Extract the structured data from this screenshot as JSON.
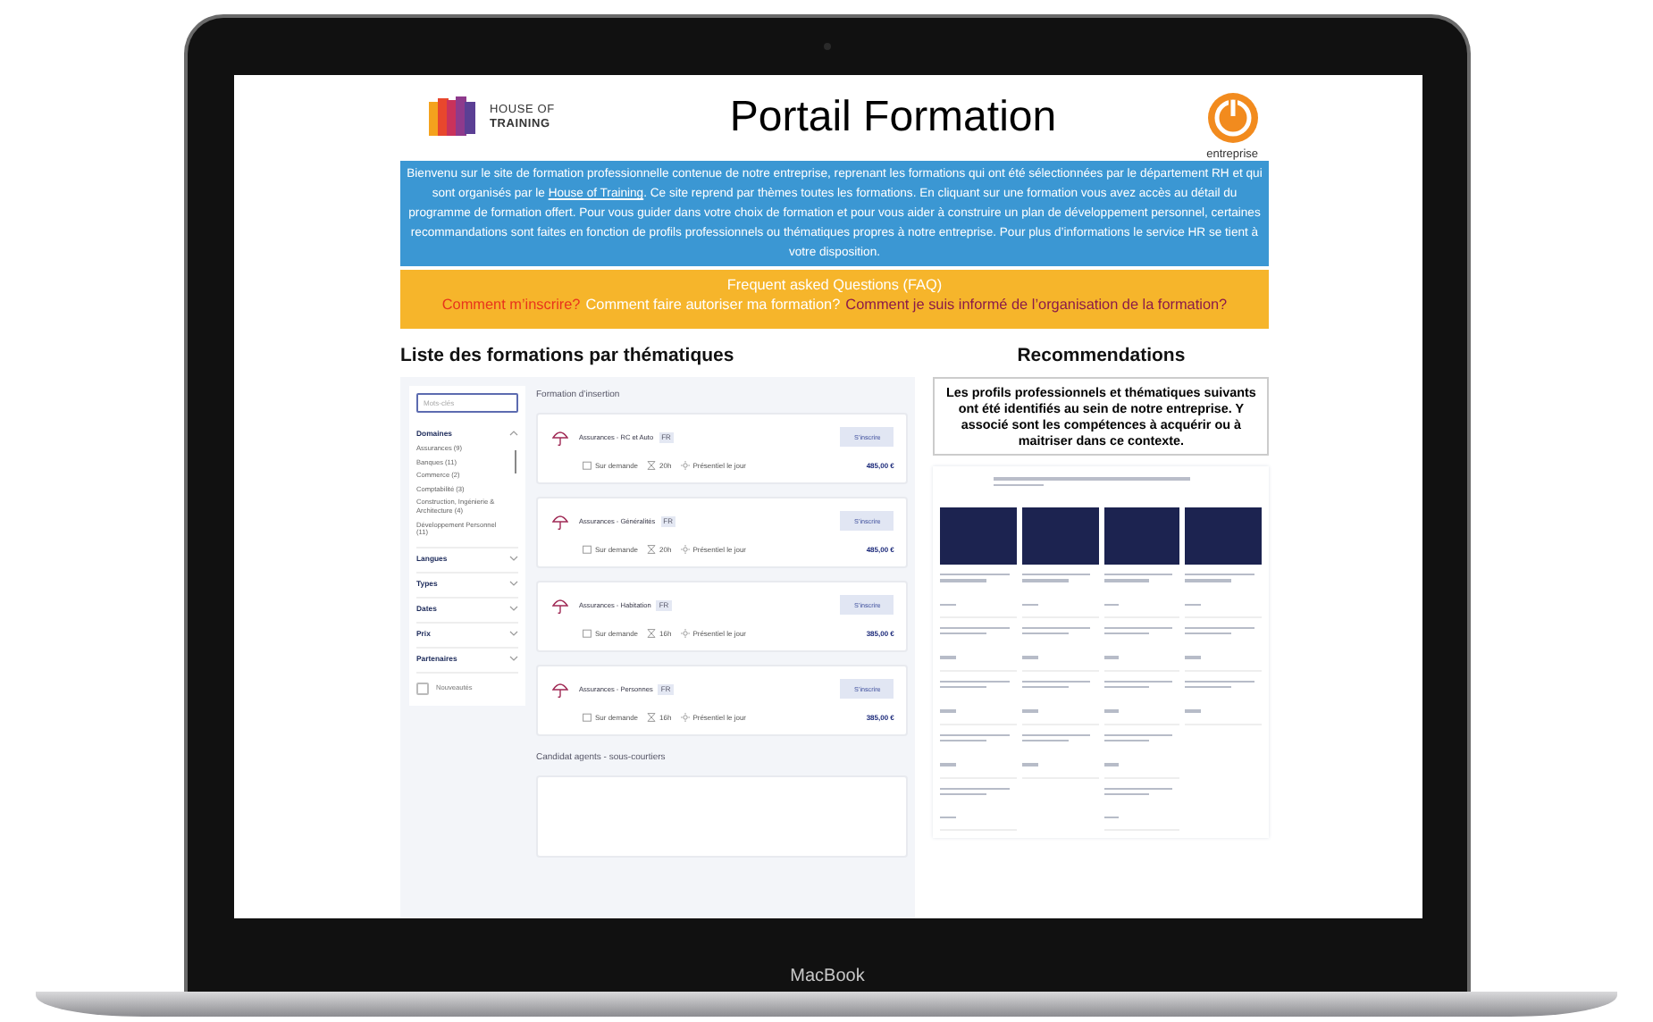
{
  "device": {
    "label": "MacBook"
  },
  "header": {
    "logo_lines": [
      "HOUSE OF",
      "TRAINING"
    ],
    "title": "Portail Formation",
    "partner_label": "entreprise"
  },
  "intro": {
    "before": "Bienvenu sur le site de formation professionnelle contenue de notre entreprise, reprenant les formations qui ont été sélectionnées par le département RH et qui sont organisés par le ",
    "link": "House of Training",
    "after": ". Ce site reprend par thèmes toutes les formations. En cliquant sur une formation vous avez accès au détail du programme de formation offert. Pour vous guider dans votre choix de formation et pour vous aider à construire un plan de développement personnel, certaines recommandations sont faites en fonction de profils professionnels ou thématiques propres à notre entreprise. Pour plus d’informations le service HR se tient à votre disposition."
  },
  "faq": {
    "title": "Frequent asked Questions (FAQ)",
    "links": [
      {
        "text": "Comment m’inscrire?",
        "color": "#e8341c"
      },
      {
        "text": "Comment faire autoriser ma formation?",
        "color": "#ffffff"
      },
      {
        "text": "Comment je suis informé de l’organisation de la formation?",
        "color": "#8b1a4a"
      }
    ]
  },
  "catalog": {
    "heading": "Liste des formations par thématiques",
    "search": {
      "placeholder": "Mots-clés"
    },
    "filters": [
      {
        "label": "Domaines",
        "expanded": true,
        "options": [
          "Assurances (9)",
          "Banques (11)",
          "Commerce (2)",
          "Comptabilité (3)",
          "Construction, Ingénierie & Architecture (4)",
          "Développement Personnel (11)"
        ]
      },
      {
        "label": "Langues",
        "expanded": false
      },
      {
        "label": "Types",
        "expanded": false
      },
      {
        "label": "Dates",
        "expanded": false
      },
      {
        "label": "Prix",
        "expanded": false
      },
      {
        "label": "Partenaires",
        "expanded": false
      }
    ],
    "new_only": {
      "label": "Nouveautés",
      "checked": false
    },
    "sections": [
      {
        "title": "Formation d’insertion",
        "courses": [
          {
            "title": "Assurances - RC et Auto",
            "language": "FR",
            "button": "S’inscrire",
            "schedule": "Sur demande",
            "duration": "20h",
            "mode": "Présentiel le jour",
            "price": "485,00 €"
          },
          {
            "title": "Assurances - Généralités",
            "language": "FR",
            "button": "S’inscrire",
            "schedule": "Sur demande",
            "duration": "20h",
            "mode": "Présentiel le jour",
            "price": "485,00 €"
          },
          {
            "title": "Assurances - Habitation",
            "language": "FR",
            "button": "S’inscrire",
            "schedule": "Sur demande",
            "duration": "16h",
            "mode": "Présentiel le jour",
            "price": "385,00 €"
          },
          {
            "title": "Assurances - Personnes",
            "language": "FR",
            "button": "S’inscrire",
            "schedule": "Sur demande",
            "duration": "16h",
            "mode": "Présentiel le jour",
            "price": "385,00 €"
          }
        ]
      },
      {
        "title": "Candidat agents - sous-courtiers"
      }
    ]
  },
  "recommendations": {
    "heading": "Recommendations",
    "notice": "Les profils professionnels et thématiques suivants ont été identifiés au sein de notre entreprise. Y associé sont les compétences à acquérir ou à maitriser dans ce contexte."
  }
}
